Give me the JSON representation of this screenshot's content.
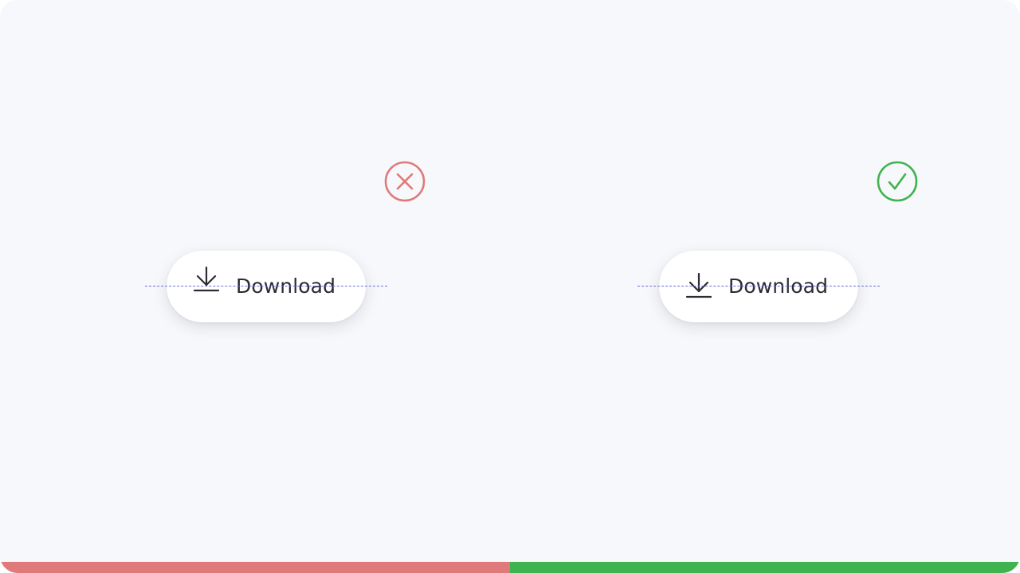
{
  "colors": {
    "wrong": "#e07a7a",
    "right": "#3fb350",
    "guide": "#6a6fe0",
    "background": "#f7f8fb",
    "text": "#2d2b33"
  },
  "left_example": {
    "status_icon": "x-circle-icon",
    "button_icon": "download-icon",
    "button_label": "Download"
  },
  "right_example": {
    "status_icon": "check-circle-icon",
    "button_icon": "download-icon",
    "button_label": "Download"
  }
}
